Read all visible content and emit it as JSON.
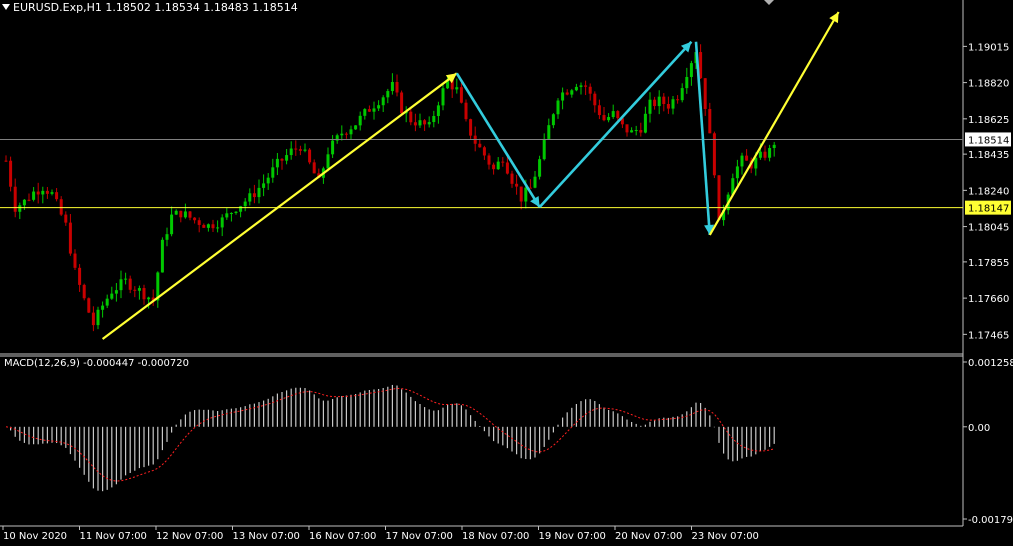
{
  "header": {
    "symbol_line": "EURUSD.Exp,H1  1.18502 1.18534 1.18483 1.18514"
  },
  "macd": {
    "label": "MACD(12,26,9) -0.000447 -0.000720"
  },
  "colors": {
    "background": "#000000",
    "bull": "#00c800",
    "bear": "#c80000",
    "yellow": "#ffff33",
    "cyan": "#33ccdd",
    "hist": "#c8c8c8",
    "signal": "#ff2020",
    "grid": "#808080"
  },
  "chart_data": [
    {
      "type": "candlestick",
      "symbol": "EURUSD.Exp",
      "timeframe": "H1",
      "ohlc_last": {
        "open": 1.18502,
        "high": 1.18534,
        "low": 1.18483,
        "close": 1.18514
      },
      "ylim": [
        1.1737,
        1.192
      ],
      "y_ticks": [
        "1.19015",
        "1.18820",
        "1.18625",
        "1.18435",
        "1.18240",
        "1.18045",
        "1.17855",
        "1.17660",
        "1.17465"
      ],
      "y_tick_values": [
        1.19015,
        1.1882,
        1.18625,
        1.18435,
        1.1824,
        1.18045,
        1.17855,
        1.1766,
        1.17465
      ],
      "x_ticks": [
        "10 Nov 2020",
        "11 Nov 07:00",
        "12 Nov 07:00",
        "13 Nov 07:00",
        "16 Nov 07:00",
        "17 Nov 07:00",
        "18 Nov 07:00",
        "19 Nov 07:00",
        "20 Nov 07:00",
        "23 Nov 07:00"
      ],
      "current_price_label": "1.18514",
      "current_price": 1.18514,
      "level_label": "1.18147",
      "level_price": 1.18147,
      "path_points": [
        [
          0,
          1.184
        ],
        [
          2,
          1.1815
        ],
        [
          4,
          1.1818
        ],
        [
          6,
          1.1823
        ],
        [
          8,
          1.1826
        ],
        [
          10,
          1.1822
        ],
        [
          13,
          1.1805
        ],
        [
          15,
          1.178
        ],
        [
          17,
          1.1765
        ],
        [
          19,
          1.1752
        ],
        [
          21,
          1.1762
        ],
        [
          23,
          1.177
        ],
        [
          26,
          1.1775
        ],
        [
          29,
          1.177
        ],
        [
          32,
          1.1765
        ],
        [
          34,
          1.1795
        ],
        [
          36,
          1.181
        ],
        [
          38,
          1.1812
        ],
        [
          41,
          1.1808
        ],
        [
          44,
          1.1805
        ],
        [
          47,
          1.1808
        ],
        [
          50,
          1.1815
        ],
        [
          53,
          1.182
        ],
        [
          56,
          1.1828
        ],
        [
          59,
          1.1838
        ],
        [
          62,
          1.1845
        ],
        [
          64,
          1.1848
        ],
        [
          66,
          1.1838
        ],
        [
          68,
          1.1828
        ],
        [
          70,
          1.1845
        ],
        [
          73,
          1.1855
        ],
        [
          76,
          1.186
        ],
        [
          79,
          1.1868
        ],
        [
          82,
          1.1875
        ],
        [
          84,
          1.188
        ],
        [
          86,
          1.1868
        ],
        [
          88,
          1.1862
        ],
        [
          90,
          1.186
        ],
        [
          92,
          1.1858
        ],
        [
          94,
          1.1872
        ],
        [
          96,
          1.1883
        ],
        [
          98,
          1.1878
        ],
        [
          100,
          1.186
        ],
        [
          102,
          1.185
        ],
        [
          104,
          1.1843
        ],
        [
          106,
          1.1835
        ],
        [
          108,
          1.1842
        ],
        [
          110,
          1.183
        ],
        [
          112,
          1.182
        ],
        [
          114,
          1.1825
        ],
        [
          116,
          1.184
        ],
        [
          118,
          1.1858
        ],
        [
          120,
          1.1875
        ],
        [
          122,
          1.1878
        ],
        [
          124,
          1.1882
        ],
        [
          126,
          1.188
        ],
        [
          128,
          1.187
        ],
        [
          130,
          1.1862
        ],
        [
          132,
          1.1865
        ],
        [
          134,
          1.1858
        ],
        [
          136,
          1.1855
        ],
        [
          138,
          1.1858
        ],
        [
          140,
          1.187
        ],
        [
          142,
          1.1872
        ],
        [
          144,
          1.187
        ],
        [
          146,
          1.1875
        ],
        [
          148,
          1.1888
        ],
        [
          150,
          1.19
        ],
        [
          152,
          1.187
        ],
        [
          154,
          1.1835
        ],
        [
          155,
          1.1805
        ],
        [
          156,
          1.1815
        ],
        [
          158,
          1.1833
        ],
        [
          160,
          1.184
        ],
        [
          162,
          1.1838
        ],
        [
          164,
          1.1842
        ],
        [
          166,
          1.1845
        ],
        [
          167,
          1.185
        ]
      ],
      "candle_count": 168,
      "annotations": [
        {
          "color": "yellow",
          "from": [
            21,
            1.1744
          ],
          "to": [
            98,
            1.1887
          ],
          "arrow": true
        },
        {
          "color": "cyan",
          "from": [
            98,
            1.1887
          ],
          "to": [
            116,
            1.1815
          ],
          "arrow": true
        },
        {
          "color": "cyan",
          "from": [
            116,
            1.1815
          ],
          "to": [
            149,
            1.1904
          ],
          "arrow": true
        },
        {
          "color": "cyan",
          "from": [
            150,
            1.1904
          ],
          "to": [
            153,
            1.18
          ],
          "arrow": true
        },
        {
          "color": "yellow",
          "from": [
            153,
            1.18
          ],
          "to": [
            181,
            1.192
          ],
          "arrow": true
        }
      ]
    },
    {
      "type": "bar",
      "name": "MACD(12,26,9)",
      "main": -0.000447,
      "signal": -0.00072,
      "ylim": [
        -0.00179,
        0.001258
      ],
      "y_ticks": [
        "0.001258",
        "0.00",
        "-0.00179"
      ],
      "y_tick_values": [
        0.001258,
        0.0,
        -0.00179
      ]
    }
  ]
}
